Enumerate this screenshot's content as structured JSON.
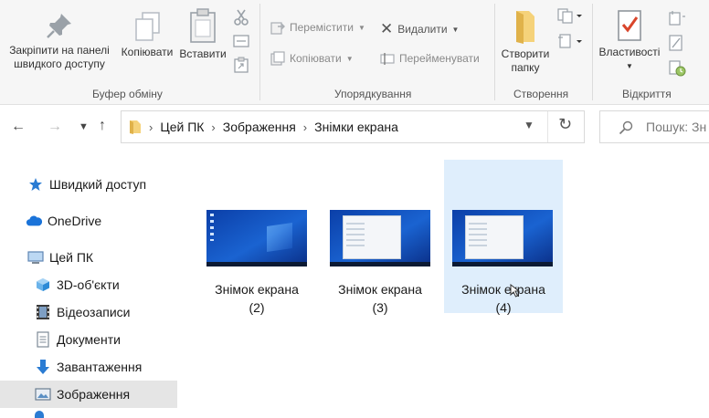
{
  "ribbon": {
    "clipboard": {
      "pin_label": "Закріпити на панелі швидкого доступу",
      "copy_label": "Копіювати",
      "paste_label": "Вставити",
      "group_label": "Буфер обміну"
    },
    "organize": {
      "move_label": "Перемістити",
      "copy_to_label": "Копіювати",
      "delete_label": "Видалити",
      "rename_label": "Перейменувати",
      "group_label": "Упорядкування"
    },
    "new": {
      "new_folder_label": "Створити папку",
      "group_label": "Створення"
    },
    "open": {
      "properties_label": "Властивості",
      "group_label": "Відкриття"
    }
  },
  "address": {
    "crumbs": [
      "Цей ПК",
      "Зображення",
      "Знімки екрана"
    ]
  },
  "search": {
    "placeholder": "Пошук: Зн"
  },
  "nav": {
    "items": [
      {
        "label": "Швидкий доступ",
        "icon": "star-icon"
      },
      {
        "label": "OneDrive",
        "icon": "cloud-icon"
      },
      {
        "label": "Цей ПК",
        "icon": "computer-icon"
      },
      {
        "label": "3D-об'єкти",
        "icon": "cube-icon"
      },
      {
        "label": "Відеозаписи",
        "icon": "film-icon"
      },
      {
        "label": "Документи",
        "icon": "document-icon"
      },
      {
        "label": "Завантаження",
        "icon": "download-icon"
      },
      {
        "label": "Зображення",
        "icon": "pictures-icon"
      }
    ]
  },
  "files": [
    {
      "name": "Знімок екрана",
      "num": "(2)"
    },
    {
      "name": "Знімок екрана",
      "num": "(3)"
    },
    {
      "name": "Знімок екрана",
      "num": "(4)"
    }
  ],
  "colors": {
    "selection": "#dfeefc",
    "accent": "#0078d7",
    "nav_selected": "#e5e5e5"
  }
}
